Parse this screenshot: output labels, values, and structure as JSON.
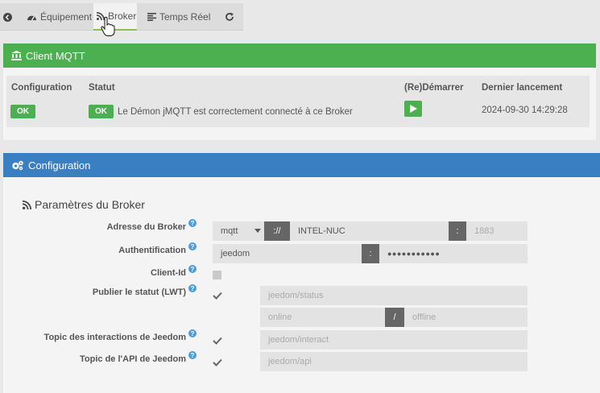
{
  "tabs": {
    "equipment": "Équipement",
    "broker": "Broker",
    "realtime": "Temps Réel"
  },
  "mqtt_panel": {
    "title": "Client MQTT",
    "headers": {
      "configuration": "Configuration",
      "status": "Statut",
      "restart": "(Re)Démarrer",
      "last_launch": "Dernier lancement"
    },
    "config_badge": "OK",
    "status_badge": "OK",
    "status_text": "Le Démon jMQTT est correctement connecté à ce Broker",
    "last_launch_value": "2024-09-30 14:29:28"
  },
  "config_panel": {
    "title": "Configuration",
    "section_title": "Paramètres du Broker",
    "address_label": "Adresse du Broker",
    "protocol_value": "mqtt",
    "protocol_sep": "://",
    "host_value": "INTEL-NUC",
    "port_sep": ":",
    "port_placeholder": "1883",
    "auth_label": "Authentification",
    "user_value": "jeedom",
    "auth_sep": ":",
    "password_value": "●●●●●●●●●●●",
    "clientid_label": "Client-Id",
    "lwt_label": "Publier le statut (LWT)",
    "lwt_topic_placeholder": "jeedom/status",
    "lwt_online_placeholder": "online",
    "lwt_sep": "/",
    "lwt_offline_placeholder": "offline",
    "interact_label": "Topic des interactions de Jeedom",
    "interact_placeholder": "jeedom/interact",
    "api_label": "Topic de l'API de Jeedom",
    "api_placeholder": "jeedom/api",
    "help_glyph": "?"
  },
  "colors": {
    "green": "#4caf50",
    "blue": "#3a7fc1",
    "help": "#4a9ee0"
  }
}
